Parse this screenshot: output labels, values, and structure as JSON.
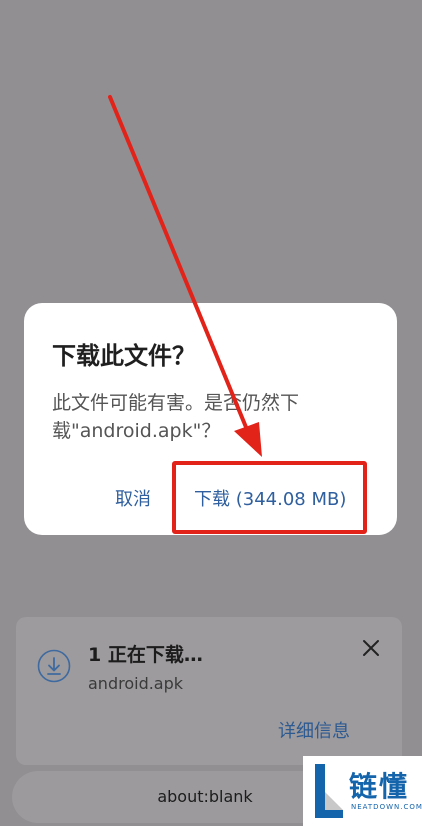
{
  "dialog": {
    "title": "下载此文件？",
    "message": "此文件可能有害。是否仍然下载\"android.apk\"？",
    "cancel_label": "取消",
    "download_label": "下载 (344.08 MB)"
  },
  "snackbar": {
    "title": "1 正在下载…",
    "filename": "android.apk",
    "details_label": "详细信息"
  },
  "address_bar": {
    "url": "about:blank"
  },
  "watermark": {
    "cn": "链懂",
    "en": "NEATDOWN.COM"
  },
  "colors": {
    "accent": "#2f5f9e",
    "highlight": "#e2231a",
    "scrim": "#918f92"
  },
  "icons": {
    "download": "download-circle-icon",
    "close": "close-icon"
  }
}
